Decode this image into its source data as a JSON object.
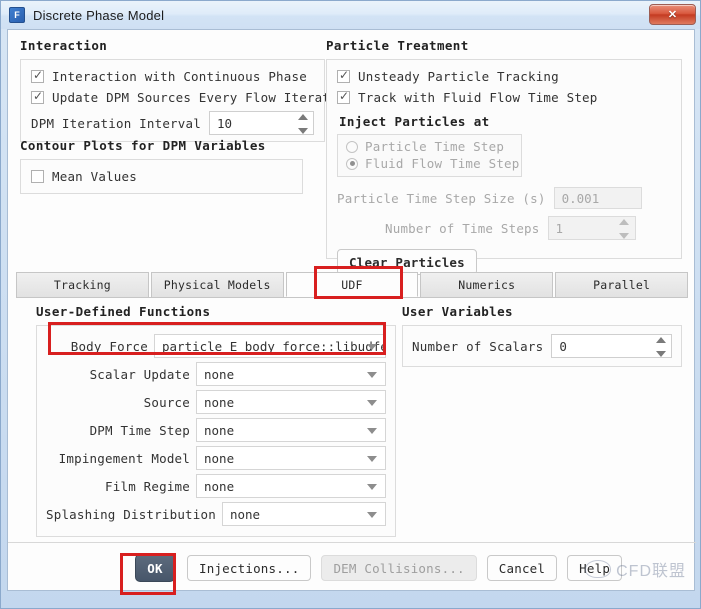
{
  "window": {
    "title": "Discrete Phase Model",
    "app_icon": "fluent-f-icon",
    "close_label": "✕"
  },
  "interaction": {
    "title": "Interaction",
    "checkboxes": [
      {
        "label": "Interaction with Continuous Phase",
        "checked": true
      },
      {
        "label": "Update DPM Sources Every Flow Iteration",
        "checked": true
      }
    ],
    "iteration_interval": {
      "label": "DPM Iteration Interval",
      "value": "10"
    }
  },
  "contour_plots": {
    "title": "Contour Plots for DPM Variables",
    "checkboxes": [
      {
        "label": "Mean Values",
        "checked": false
      }
    ]
  },
  "particle_treatment": {
    "title": "Particle Treatment",
    "checkboxes": [
      {
        "label": "Unsteady Particle Tracking",
        "checked": true
      },
      {
        "label": "Track with Fluid Flow Time Step",
        "checked": true
      }
    ],
    "inject_title": "Inject Particles at",
    "radios": [
      {
        "label": "Particle Time Step",
        "selected": false
      },
      {
        "label": "Fluid Flow Time Step",
        "selected": true
      }
    ],
    "time_step_size": {
      "label": "Particle Time Step Size (s)",
      "value": "0.001"
    },
    "number_of_time_steps": {
      "label": "Number of Time Steps",
      "value": "1"
    },
    "clear_particles_label": "Clear Particles"
  },
  "tabs": [
    {
      "label": "Tracking",
      "active": false
    },
    {
      "label": "Physical Models",
      "active": false
    },
    {
      "label": "UDF",
      "active": true
    },
    {
      "label": "Numerics",
      "active": false
    },
    {
      "label": "Parallel",
      "active": false
    }
  ],
  "udf": {
    "title": "User-Defined Functions",
    "fields": [
      {
        "label": "Body Force",
        "value": "particle_E_body_force::libudfee"
      },
      {
        "label": "Scalar Update",
        "value": "none"
      },
      {
        "label": "Source",
        "value": "none"
      },
      {
        "label": "DPM Time Step",
        "value": "none"
      },
      {
        "label": "Impingement Model",
        "value": "none"
      },
      {
        "label": "Film Regime",
        "value": "none"
      },
      {
        "label": "Splashing Distribution",
        "value": "none"
      }
    ]
  },
  "user_variables": {
    "title": "User Variables",
    "number_of_scalars": {
      "label": "Number of Scalars",
      "value": "0"
    }
  },
  "buttons": [
    {
      "label": "OK",
      "style": "primary"
    },
    {
      "label": "Injections...",
      "style": "normal"
    },
    {
      "label": "DEM Collisions...",
      "style": "disabled"
    },
    {
      "label": "Cancel",
      "style": "normal"
    },
    {
      "label": "Help",
      "style": "normal"
    }
  ],
  "watermark": {
    "text": "CFD联盟"
  },
  "annotations": {
    "color": "#d81f1f",
    "boxes": [
      "udf-tab",
      "body-force-field",
      "ok-button"
    ]
  }
}
